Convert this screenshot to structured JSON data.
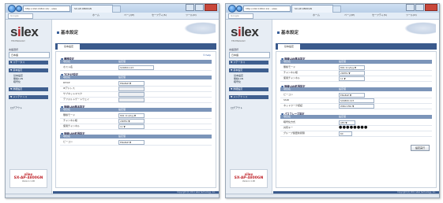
{
  "browser": {
    "address": "http://192.168.0.12/ - silex",
    "tab_title": "SX-AP-4800GN",
    "search_placeholder": "Google",
    "cmd_home": "ホーム",
    "cmd_page": "ページ(P)",
    "cmd_safety": "セーフティ(S)",
    "cmd_tools": "ツール(O)"
  },
  "sidebar": {
    "logo_pre": "s",
    "logo_i": "i",
    "logo_post": "lex",
    "tagline": "TECHNOLOGY",
    "lang_header": "言語選択",
    "lang_value": "日本語",
    "status_item": "▼ ステータス",
    "basic_item": "▼ 基本設定",
    "sub_items": [
      "基本設定",
      "無線LAN",
      "暗号化"
    ],
    "detail_item": "▼ 詳細設定",
    "maint_item": "▼ メンテナンス",
    "logout": "ログアウト",
    "brand": "silex",
    "model": "SX-AP-4800GN",
    "version": "Version 1.00"
  },
  "main": {
    "page_title": "基本設定",
    "tab_label": "基本設定",
    "help": "① help",
    "footer": "Copyright (C) 2011 silex technology, Inc.",
    "set_button": "設定実行"
  },
  "left_panel": {
    "sections": [
      {
        "title": "機器設定",
        "col1": "項目名",
        "col2": "設定値",
        "rows": [
          {
            "label": "ホスト名",
            "value": "SX4800-123"
          }
        ]
      },
      {
        "title": "TCP/IP設定",
        "col1": "項目名",
        "col2": "設定値",
        "rows": [
          {
            "label": "DHCP",
            "value": "ENABLE ▼"
          },
          {
            "label": "IPアドレス",
            "value": ""
          },
          {
            "label": "サブネットマスク",
            "value": ""
          },
          {
            "label": "デフォルトゲートウェイ",
            "value": ""
          }
        ]
      },
      {
        "title": "無線LAN基本設定",
        "col1": "項目名",
        "col2": "設定値",
        "rows": [
          {
            "label": "無線モード",
            "value": "802.11n/b/g ▼"
          },
          {
            "label": "チャンネル幅",
            "value": "20MHz ▼"
          },
          {
            "label": "使用チャンネル",
            "value": "11 ▼"
          }
        ]
      },
      {
        "title": "無線LAN拡張設定",
        "col1": "項目名",
        "col2": "設定値",
        "rows": [
          {
            "label": "ビーコン",
            "value": "ENABLE ▼"
          }
        ]
      }
    ]
  },
  "right_panel": {
    "sections": [
      {
        "title": "無線LAN基本設定",
        "col1": "項目名",
        "col2": "設定値",
        "rows": [
          {
            "label": "無線モード",
            "value": "802.11n/b/g ▼"
          },
          {
            "label": "チャンネル幅",
            "value": "20MHz ▼"
          },
          {
            "label": "使用チャンネル",
            "value": "11 ▼"
          }
        ]
      },
      {
        "title": "無線LAN拡張設定",
        "col1": "項目名",
        "col2": "設定値",
        "rows": [
          {
            "label": "ビーコン",
            "value": "ENABLE ▼"
          },
          {
            "label": "SSID",
            "value": "SX4800-123"
          },
          {
            "label": "ネットワーク認証",
            "value": "WPA2-PSK ▼"
          }
        ]
      },
      {
        "title": "パスフレーズ設定",
        "col1": "項目名",
        "col2": "設定値",
        "rows": [
          {
            "label": "暗号化方式",
            "value": "AES ▼"
          },
          {
            "label": "共有キー",
            "value": "●●●●●●●●"
          },
          {
            "label": "グループ鍵更新間隔",
            "value": "60"
          }
        ]
      }
    ]
  }
}
